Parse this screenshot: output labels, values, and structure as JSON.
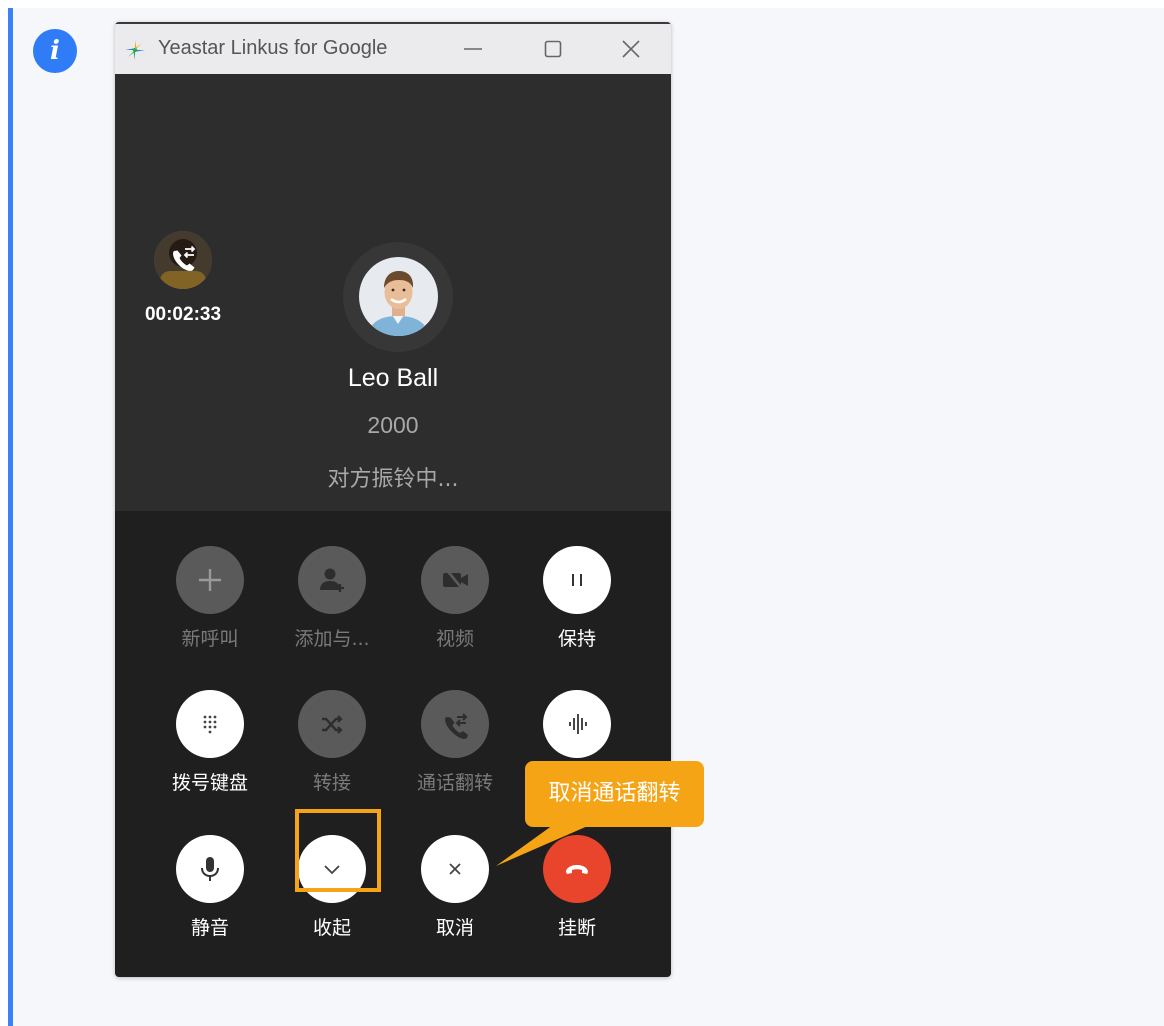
{
  "window": {
    "title": "Yeastar Linkus for Google"
  },
  "held_call": {
    "duration": "00:02:33"
  },
  "contact": {
    "name": "Leo Ball",
    "number": "2000",
    "status": "对方振铃中..."
  },
  "controls": [
    {
      "label": "新呼叫",
      "icon": "plus-icon",
      "enabled": false
    },
    {
      "label": "添加与...",
      "icon": "add-person-icon",
      "enabled": false
    },
    {
      "label": "视频",
      "icon": "video-off-icon",
      "enabled": false
    },
    {
      "label": "保持",
      "icon": "pause-icon",
      "enabled": true
    },
    {
      "label": "拨号键盘",
      "icon": "dialpad-icon",
      "enabled": true
    },
    {
      "label": "转接",
      "icon": "shuffle-icon",
      "enabled": false
    },
    {
      "label": "通话翻转",
      "icon": "call-flip-icon",
      "enabled": false
    },
    {
      "label": "",
      "icon": "voice-wave-icon",
      "enabled": true
    },
    {
      "label": "静音",
      "icon": "microphone-icon",
      "enabled": true
    },
    {
      "label": "收起",
      "icon": "chevron-down-icon",
      "enabled": true
    },
    {
      "label": "取消",
      "icon": "close-icon",
      "enabled": true
    },
    {
      "label": "挂断",
      "icon": "hang-up-icon",
      "enabled": true
    }
  ],
  "callout": {
    "text": "取消通话翻转"
  },
  "colors": {
    "accent": "#f5a416",
    "hangup": "#e8452c",
    "note_bar": "#3b82f6"
  }
}
